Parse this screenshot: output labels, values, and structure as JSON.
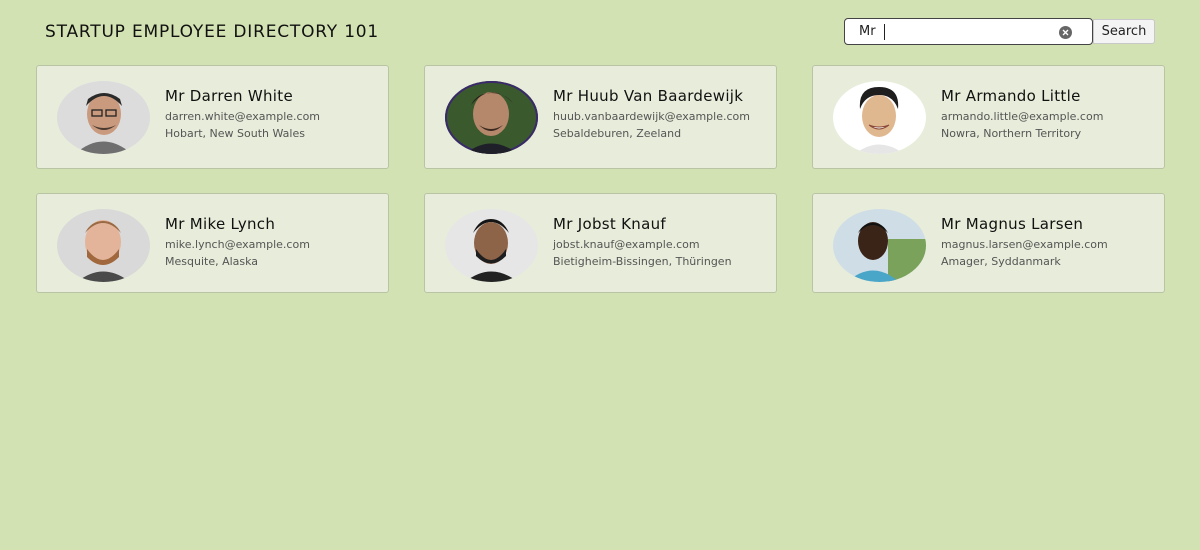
{
  "header": {
    "title": "STARTUP EMPLOYEE DIRECTORY 101"
  },
  "search": {
    "value": "Mr",
    "button_label": "Search"
  },
  "employees": [
    {
      "name": "Mr Darren White",
      "email": "darren.white@example.com",
      "location": "Hobart, New South Wales"
    },
    {
      "name": "Mr Huub Van Baardewijk",
      "email": "huub.vanbaardewijk@example.com",
      "location": "Sebaldeburen, Zeeland"
    },
    {
      "name": "Mr Armando Little",
      "email": "armando.little@example.com",
      "location": "Nowra, Northern Territory"
    },
    {
      "name": "Mr Mike Lynch",
      "email": "mike.lynch@example.com",
      "location": "Mesquite, Alaska"
    },
    {
      "name": "Mr Jobst Knauf",
      "email": "jobst.knauf@example.com",
      "location": "Bietigheim-Bissingen, Thüringen"
    },
    {
      "name": "Mr Magnus Larsen",
      "email": "magnus.larsen@example.com",
      "location": "Amager, Syddanmark"
    }
  ],
  "colors": {
    "background": "#d3e2b3",
    "card": "#e7edda",
    "card_border": "#b9c4a5"
  }
}
